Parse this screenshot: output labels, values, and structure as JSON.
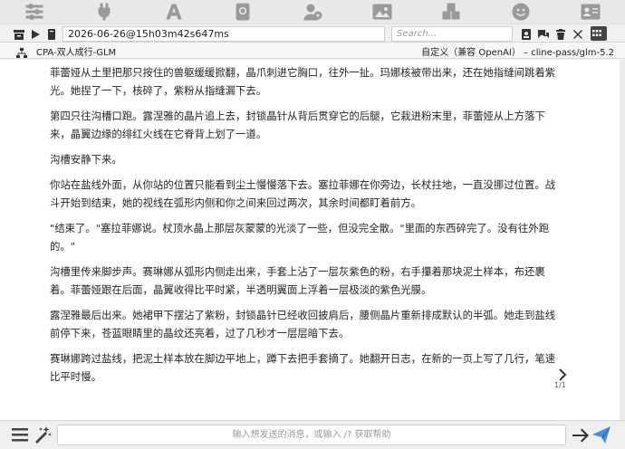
{
  "topbar": {
    "icons": [
      "sliders-icon",
      "plug-icon",
      "font-icon",
      "book-icon",
      "user-settings-icon",
      "image-icon",
      "cubes-icon",
      "smiley-icon",
      "id-card-icon"
    ]
  },
  "header": {
    "chat_name": "2026-06-26@15h03m42s647ms",
    "search_placeholder": "Search..."
  },
  "chatbar": {
    "title": "CPA-双人成行-GLM",
    "model": "自定义（兼容 OpenAI） – cline-pass/glm-5.2"
  },
  "message": {
    "paragraphs": [
      "菲蕾娅从土里把那只按住的兽躯缓缓掀翻，晶爪刺进它胸口，往外一扯。玛娜核被带出来，还在她指缝间跳着紫光。她捏了一下，核碎了，紫粉从指缝漏下去。",
      "第四只往沟槽口跑。露涅雅的晶片追上去，封锁晶针从背后贯穿它的后腿，它栽进粉末里，菲蕾娅从上方落下来，晶翼边缘的绯红火线在它脊背上划了一道。",
      "沟槽安静下来。",
      "你站在盐线外面，从你站的位置只能看到尘土慢慢落下去。塞拉菲娜在你旁边，长杖拄地，一直没挪过位置。战斗开始到结束，她的视线在弧形内侧和你之间来回过两次，其余时间都盯着前方。",
      "\"结束了。\"塞拉菲娜说。杖顶水晶上那层灰蒙蒙的光淡了一些，但没完全散。\"里面的东西碎完了。没有往外跑的。\"",
      "沟槽里传来脚步声。赛琳娜从弧形内侧走出来，手套上沾了一层灰紫色的粉，右手攥着那块泥土样本，布还裹着。菲蕾娅跟在后面，晶翼收得比平时紧，半透明翼面上浮着一层极淡的紫色光膜。",
      "露涅雅最后出来。她裙甲下摆沾了紫粉，封锁晶针已经收回披肩后，腰侧晶片重新排成默认的半弧。她走到盐线前停下来，苍蓝眼睛里的晶纹还亮着，过了几秒才一层层暗下去。",
      "赛琳娜跨过盐线，把泥土样本放在脚边平地上，蹲下去把手套摘了。她翻开日志，在新的一页上写了几行，笔速比平时慢。"
    ],
    "page_indicator": "1/1"
  },
  "composer": {
    "placeholder": "输入想发送的消息，或输入 /? 获取帮助"
  }
}
